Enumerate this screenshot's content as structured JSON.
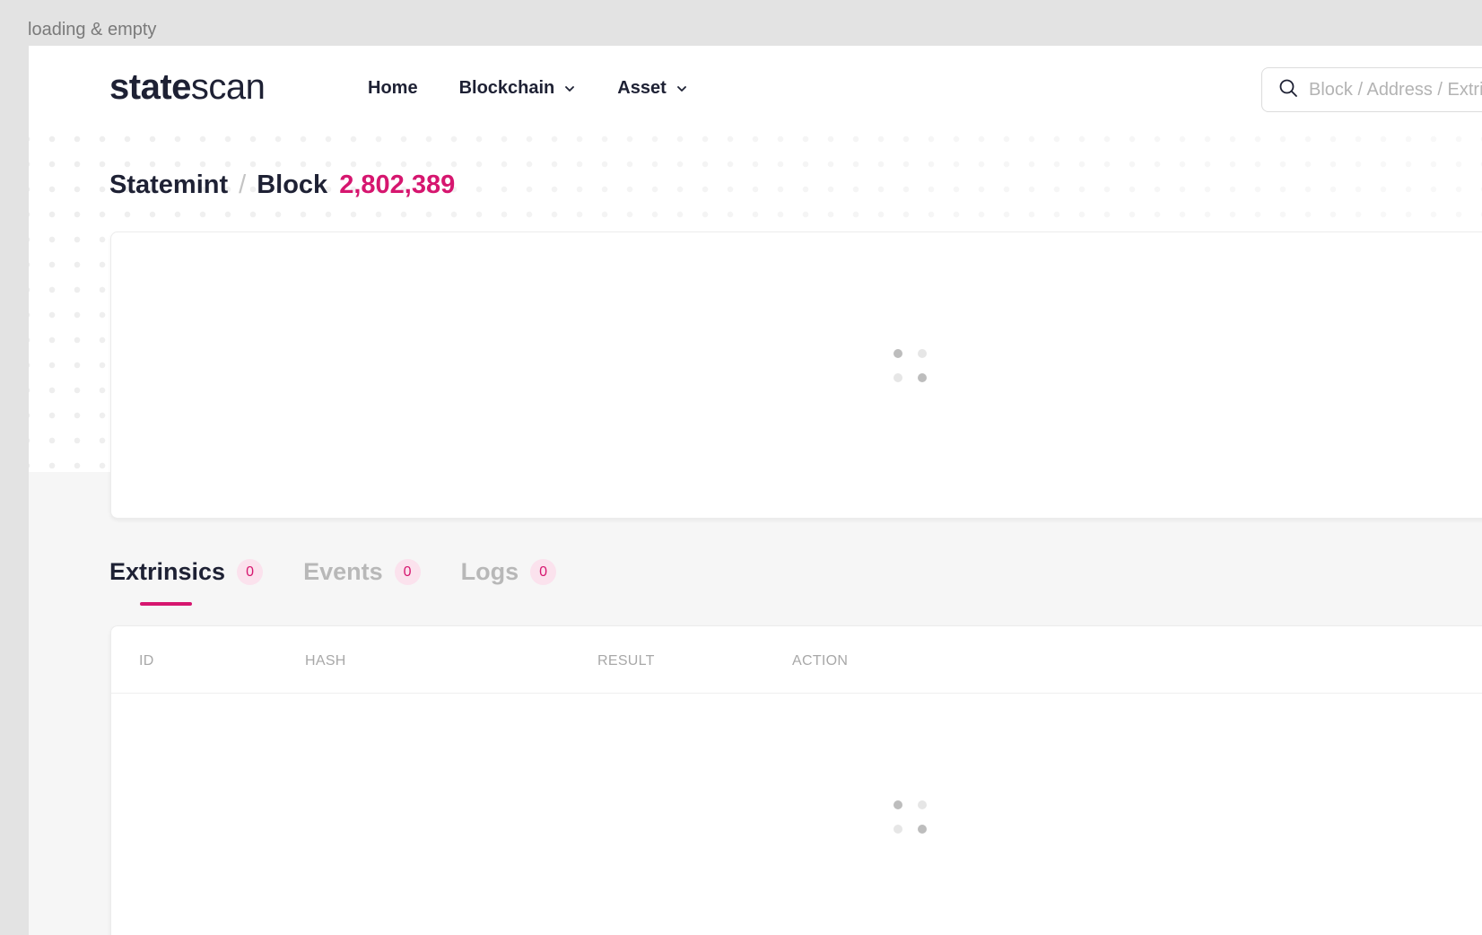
{
  "frame_label": "loading & empty",
  "header": {
    "logo_bold": "state",
    "logo_light": "scan",
    "nav": [
      {
        "label": "Home",
        "has_dropdown": false
      },
      {
        "label": "Blockchain",
        "has_dropdown": true
      },
      {
        "label": "Asset",
        "has_dropdown": true
      }
    ],
    "search": {
      "placeholder": "Block / Address / Extrinsic / Asset",
      "value": ""
    }
  },
  "breadcrumb": {
    "root": "Statemint",
    "separator": "/",
    "section": "Block",
    "number": "2,802,389"
  },
  "tabs": [
    {
      "label": "Extrinsics",
      "count": "0",
      "active": true
    },
    {
      "label": "Events",
      "count": "0",
      "active": false
    },
    {
      "label": "Logs",
      "count": "0",
      "active": false
    }
  ],
  "table": {
    "columns": [
      "ID",
      "HASH",
      "RESULT",
      "ACTION"
    ]
  },
  "colors": {
    "accent": "#d6166f",
    "badge_bg": "#fbe2ed",
    "text_primary": "#1e2134",
    "text_muted": "#b8b8b8"
  }
}
